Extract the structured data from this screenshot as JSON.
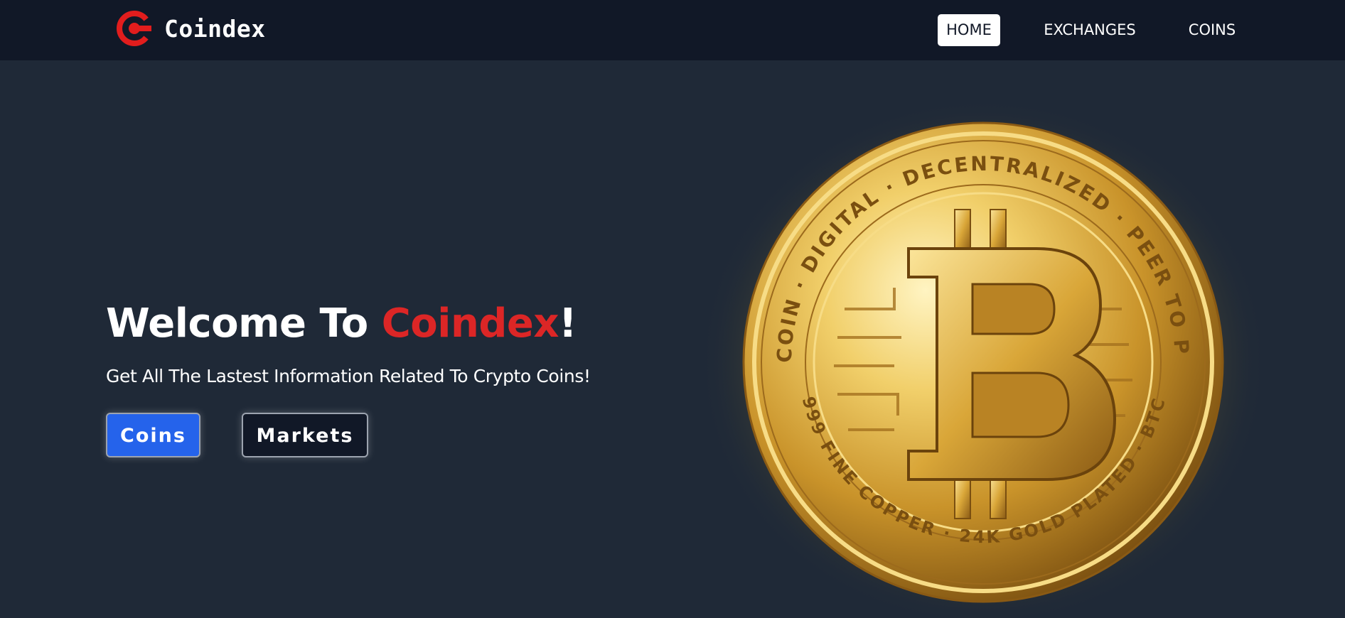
{
  "brand": {
    "name": "Coindex",
    "logo_icon": "coindex-logo-icon",
    "logo_color": "#e11d1d"
  },
  "nav": {
    "items": [
      {
        "label": "HOME",
        "active": true
      },
      {
        "label": "EXCHANGES",
        "active": false
      },
      {
        "label": "COINS",
        "active": false
      }
    ]
  },
  "hero": {
    "title_prefix": "Welcome To ",
    "title_accent": "Coindex",
    "title_suffix": "!",
    "subtitle": "Get All The Lastest Information Related To Crypto Coins!",
    "buttons": {
      "coins_label": "Coins",
      "markets_label": "Markets"
    },
    "image": {
      "icon": "bitcoin-coin-image",
      "rim_text_top": "BITCOIN · DIGITAL · DECENTRALIZED · PEER TO PEER",
      "rim_text_bottom": "999 FINE COPPER · 24K GOLD PLATED · BTC"
    }
  },
  "colors": {
    "navbar_bg": "#111827",
    "page_bg": "#1f2937",
    "accent_red": "#dc2626",
    "primary_blue": "#2563eb",
    "gold": "#d4a52c"
  }
}
